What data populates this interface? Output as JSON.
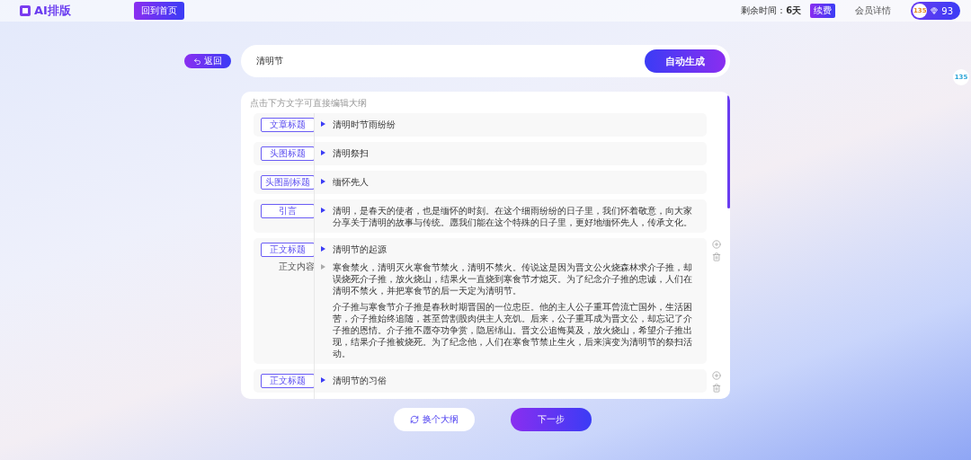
{
  "header": {
    "logo": "AI排版",
    "home_button": "回到首页",
    "remaining_label": "剩余时间：",
    "remaining_value": "6天",
    "renew_button": "续费",
    "member_link": "会员详情",
    "badge_logo": "135",
    "points": "93"
  },
  "side_badge": "135",
  "back_button": "返回",
  "topic": {
    "value": "清明节",
    "generate_button": "自动生成"
  },
  "outline": {
    "hint": "点击下方文字可直接编辑大纲",
    "rows": [
      {
        "kind": "heading",
        "tag": "文章标题",
        "title": "清明时节雨纷纷"
      },
      {
        "kind": "heading",
        "tag": "头图标题",
        "title": "清明祭扫"
      },
      {
        "kind": "heading",
        "tag": "头图副标题",
        "title": "缅怀先人"
      },
      {
        "kind": "heading",
        "tag": "引言",
        "title": "清明，是春天的使者，也是缅怀的时刻。在这个细雨纷纷的日子里，我们怀着敬意，向大家分享关于清明的故事与传统。愿我们能在这个特殊的日子里，更好地缅怀先人，传承文化。"
      },
      {
        "kind": "section",
        "tag": "正文标题",
        "title": "清明节的起源",
        "content_label": "正文内容",
        "paragraphs": [
          "寒食禁火，清明灭火寒食节禁火，清明不禁火。传说这是因为晋文公火烧森林求介子推，却误烧死介子推，放火烧山，结果火一直烧到寒食节才熄灭。为了纪念介子推的忠诚，人们在清明不禁火，并把寒食节的后一天定为清明节。",
          "介子推与寒食节介子推是春秋时期晋国的一位忠臣。他的主人公子重耳曾流亡国外，生活困苦，介子推始终追随，甚至曾割股肉供主人充饥。后来，公子重耳成为晋文公，却忘记了介子推的恩情。介子推不愿夺功争赏，隐居绵山。晋文公追悔莫及，放火烧山，希望介子推出现，结果介子推被烧死。为了纪念他，人们在寒食节禁止生火，后来演变为清明节的祭扫活动。"
        ]
      },
      {
        "kind": "section",
        "tag": "正文标题",
        "title": "清明节的习俗"
      }
    ]
  },
  "footer": {
    "change_button": "换个大纲",
    "next_button": "下一步"
  }
}
